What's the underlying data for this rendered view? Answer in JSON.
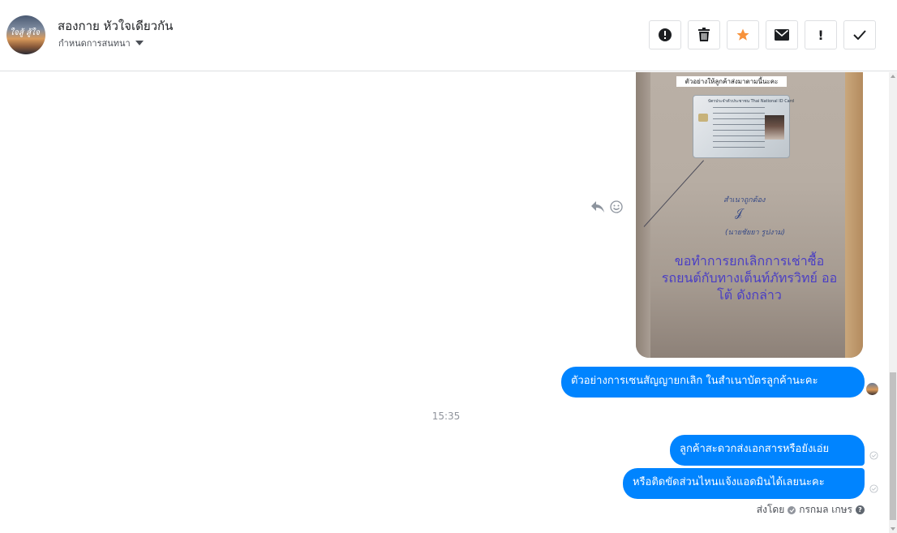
{
  "header": {
    "title": "สองกาย หัวใจเดียวกัน",
    "subtitle": "กำหนดการสนทนา",
    "avatar_text": "ใจสู้ สู้ใจ"
  },
  "toolbar": [
    {
      "name": "report-button",
      "icon": "alert-circle-icon",
      "label": ""
    },
    {
      "name": "delete-button",
      "icon": "trash-icon",
      "label": ""
    },
    {
      "name": "star-button",
      "icon": "star-icon",
      "label": ""
    },
    {
      "name": "mark-unread-button",
      "icon": "envelope-icon",
      "label": ""
    },
    {
      "name": "spam-button",
      "icon": "exclamation-icon",
      "label": "!"
    },
    {
      "name": "mark-done-button",
      "icon": "check-icon",
      "label": ""
    }
  ],
  "photo": {
    "label": "ตัวอย่างให้ลูกค้าส่งมาตามนี้นะคะ",
    "id_card_title": "บัตรประจำตัวประชาชน Thai National ID Card",
    "signature_top": "สำเนาถูกต้อง",
    "signature_name": "(นายชัยยา รูปงาม)",
    "handwritten": "ขอทำการยกเลิกการเช่าซื้อ รถยนต์กับทางเต็นท์ภัทรวิทย์ ออโต้ ดังกล่าว"
  },
  "messages": [
    {
      "text": "ตัวอย่างการเซนสัญญายกเลิก ในสำเนาบัตรลูกค้านะคะ"
    },
    {
      "text": "ลูกค้าสะดวกส่งเอกสารหรือยังเอ่ย"
    },
    {
      "text": "หรือติดขัดส่วนไหนแจ้งแอดมินได้เลยนะคะ"
    }
  ],
  "timestamp": "15:35",
  "sent_by": {
    "prefix": "ส่งโดย",
    "name": "กรกมล เกษร"
  },
  "colors": {
    "bubble": "#0084ff",
    "star": "#f7923b",
    "border": "#dddfe2"
  }
}
